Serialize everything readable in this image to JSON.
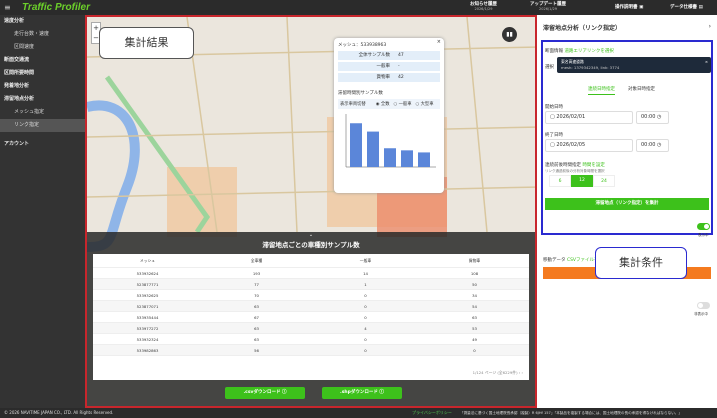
{
  "header": {
    "logo": "Traffic Profiler",
    "news": "お知らせ履歴",
    "news_date": "2026/1/29",
    "update": "アップデート履歴",
    "update_date": "2026/1/29",
    "manual": "操作説明書",
    "spec": "データ仕様書"
  },
  "sidebar": {
    "items": [
      {
        "label": "速度分析",
        "level": 0
      },
      {
        "label": "走行台数・速度",
        "level": 1
      },
      {
        "label": "区間速度",
        "level": 1
      },
      {
        "label": "断面交通流",
        "level": 0
      },
      {
        "label": "区間所要時間",
        "level": 0
      },
      {
        "label": "発着地分析",
        "level": 0
      },
      {
        "label": "滞留地点分析",
        "level": 0
      },
      {
        "label": "メッシュ指定",
        "level": 1
      },
      {
        "label": "リンク指定",
        "level": 1,
        "active": true
      },
      {
        "label": "アカウント",
        "level": 0
      }
    ]
  },
  "map": {
    "zoom_in": "+",
    "zoom_out": "−",
    "popup": {
      "mesh": "メッシュ：533938963",
      "rows": [
        {
          "k": "全体サンプル数",
          "v": "47"
        },
        {
          "k": "一般車",
          "v": "-"
        },
        {
          "k": "貨物車",
          "v": "42"
        }
      ],
      "chart_title": "滞留時間別サンプル数",
      "switch_label": "表示車両切替",
      "radios": [
        "全数",
        "一般車",
        "大型車"
      ],
      "selected": "全数"
    },
    "callout": "集計結果"
  },
  "chart_data": {
    "type": "bar",
    "values": [
      10.5,
      8.5,
      4.5,
      4,
      3.5
    ],
    "ylim": [
      0,
      12
    ],
    "color": "#5b86d9"
  },
  "results": {
    "title": "滞留地点ごとの車種別サンプル数",
    "headers": [
      "メッシュ",
      "全車種",
      "一般車",
      "貨物車"
    ],
    "rows": [
      [
        "533932624",
        "193",
        "14",
        "108"
      ],
      [
        "523877771",
        "77",
        "1",
        "50"
      ],
      [
        "533932625",
        "70",
        "0",
        "34"
      ],
      [
        "523877071",
        "63",
        "0",
        "54"
      ],
      [
        "533935444",
        "67",
        "0",
        "63"
      ],
      [
        "533977272",
        "63",
        "4",
        "53"
      ],
      [
        "533932324",
        "63",
        "0",
        "49"
      ],
      [
        "533982863",
        "56",
        "0",
        "0"
      ]
    ],
    "pagination": "1/124 ページ (全6229件)",
    "csv": ".csvダウンロード ⓘ",
    "shp": ".shpダウンロード ⓘ"
  },
  "panel": {
    "title": "滞留地点分析（リンク指定）",
    "section_label": "断面情報",
    "section_link": "道路エリアリンクを選択",
    "select_label": "選択",
    "chip_title": "東名高速道路",
    "chip_sub": "mesh: 1379342349, link: 3774",
    "tabs": [
      "連続日時指定",
      "対象日時指定"
    ],
    "start_label": "開始日時",
    "start_date": "2026/02/01",
    "start_time": "00:00",
    "end_label": "終了日時",
    "end_date": "2026/02/05",
    "end_time": "00:00",
    "range_label": "連続前後時間指定",
    "range_link": "時間を設定",
    "range_hint": "リンク通過前後の分析対象時間を選択",
    "hours": [
      "6",
      "12",
      "24"
    ],
    "selected_hour": "12",
    "aggregate": "滞留地点（リンク指定）を集計",
    "toggle1": "表示中",
    "move_label": "移動データ",
    "move_link": "CSVファイルを...",
    "toggle2": "非表示中",
    "callout": "集計条件"
  },
  "footer": {
    "copyright": "© 2026 NAVITIME JAPAN CO., LTD. All Rights Reserved.",
    "privacy": "プライバシーポリシー",
    "notice": "「測量法に基づく国土地理院長承認（複製）R 6JHf 157」「本製品を複製する場合には、国土地理院の長の承認を得なければならない。」"
  }
}
